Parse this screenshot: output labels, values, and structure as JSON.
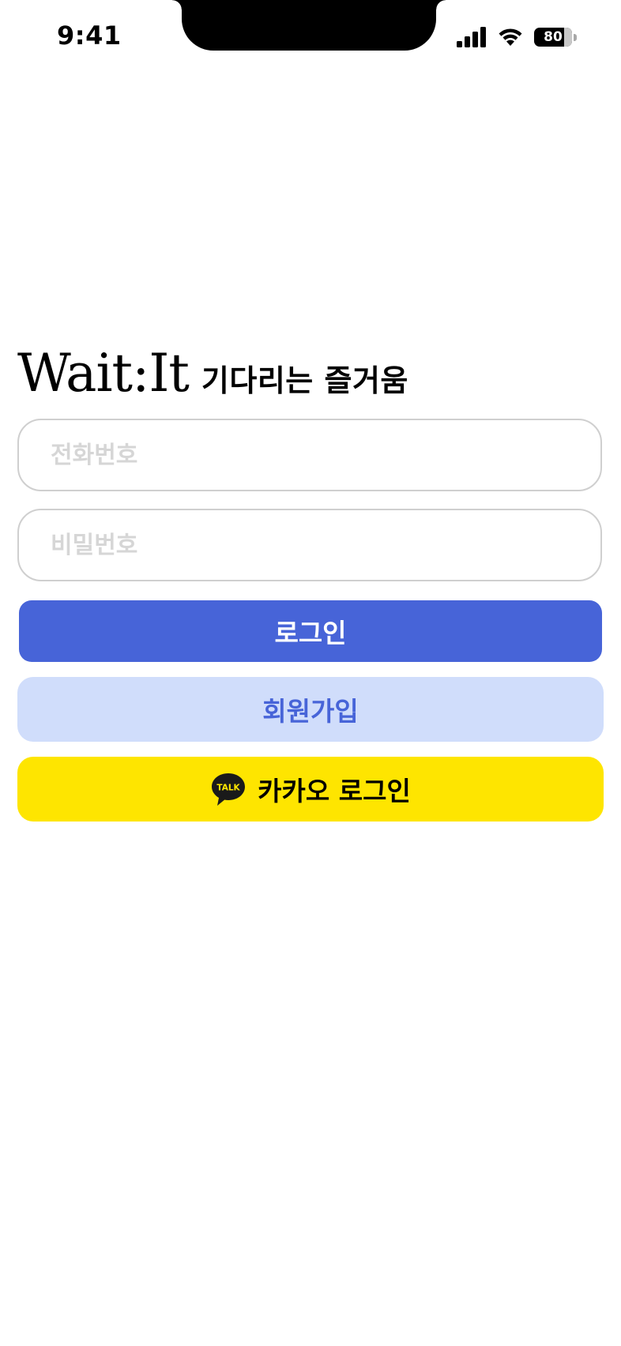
{
  "status_bar": {
    "time": "9:41",
    "battery_level": "80",
    "battery_percent": 80,
    "icons": [
      "signal-icon",
      "wifi-icon",
      "battery-icon"
    ]
  },
  "header": {
    "brand": "Wait:It",
    "tagline": "기다리는 즐거움"
  },
  "form": {
    "phone_placeholder": "전화번호",
    "password_placeholder": "비밀번호",
    "phone_value": "",
    "password_value": ""
  },
  "buttons": {
    "login_label": "로그인",
    "signup_label": "회원가입",
    "kakao_label": "카카오 로그인",
    "kakao_icon_text": "TALK",
    "kakao_icon": "kakao-talk-icon"
  },
  "colors": {
    "primary": "#4764d8",
    "primary_light": "#d0ddfb",
    "kakao_yellow": "#fee500",
    "input_border": "#cfcfcf",
    "placeholder": "#d6d6d6"
  }
}
